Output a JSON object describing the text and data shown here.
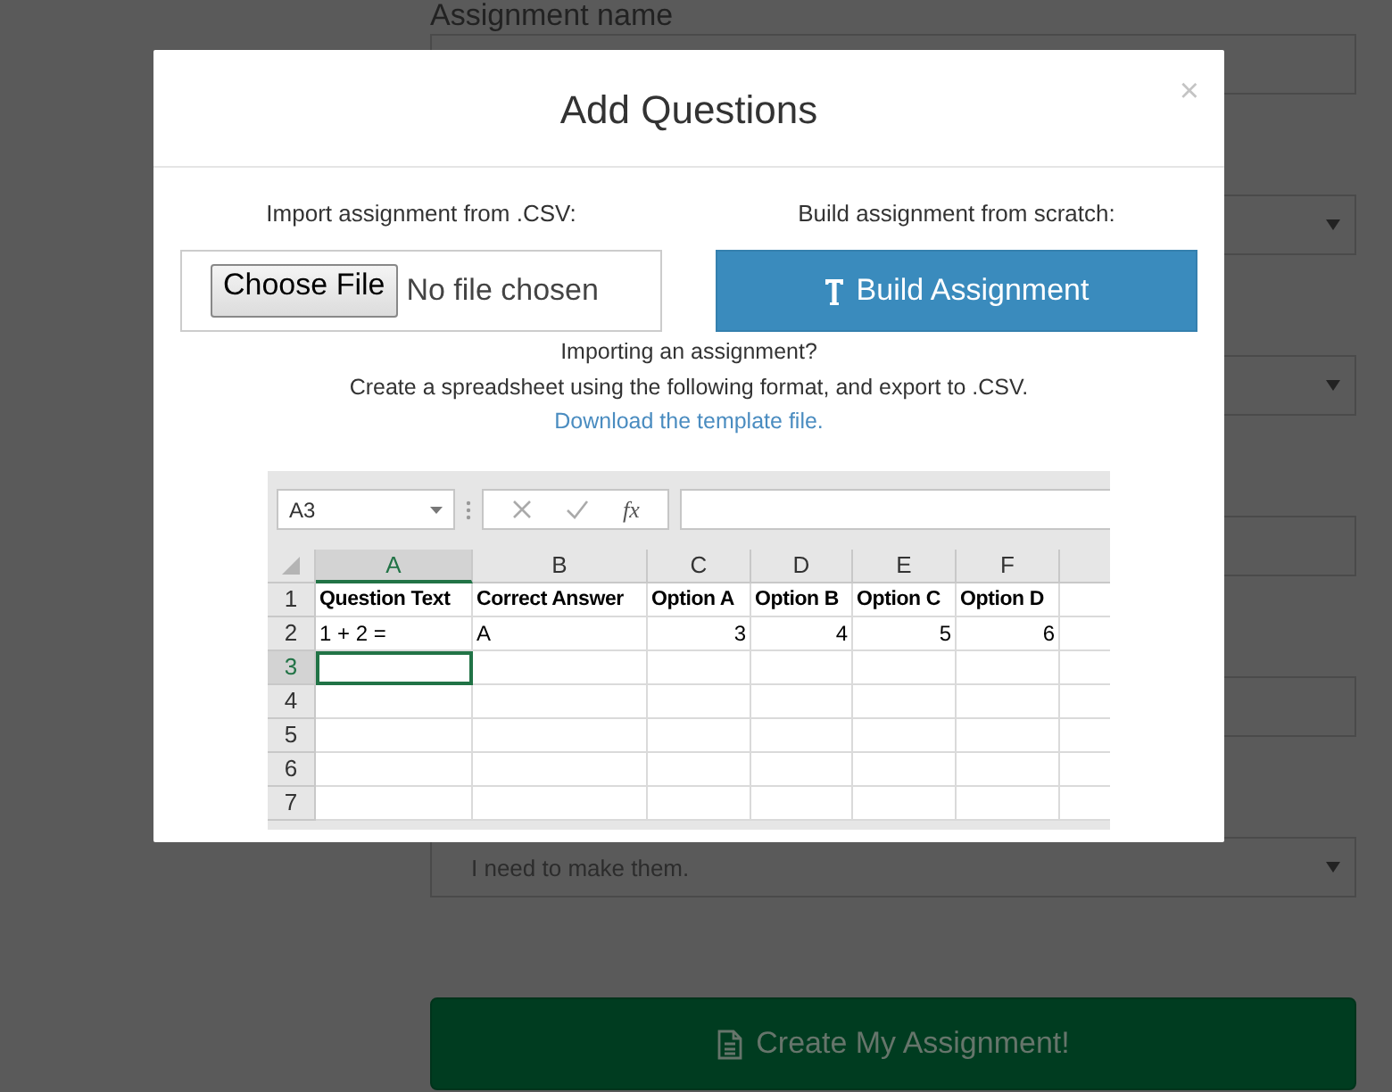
{
  "background_form": {
    "heading": "Assignment name",
    "fields": [
      {
        "kind": "input"
      },
      {
        "kind": "select"
      },
      {
        "kind": "select"
      },
      {
        "kind": "input"
      },
      {
        "kind": "input"
      },
      {
        "kind": "select",
        "value": "I need to make them."
      }
    ],
    "submit_button": "Create My Assignment!"
  },
  "modal": {
    "title": "Add Questions",
    "close": "×",
    "import_label": "Import assignment from .CSV:",
    "file_button": "Choose File",
    "file_status": "No file chosen",
    "build_label": "Build assignment from scratch:",
    "build_button": "Build Assignment",
    "help_lines": [
      "Importing an assignment?",
      "Create a spreadsheet using the following format, and export to .CSV."
    ],
    "template_link": "Download the template file.",
    "spreadsheet": {
      "name_box": "A3",
      "formula_symbol": "fx",
      "columns": [
        {
          "label": "A",
          "selected": true
        },
        {
          "label": "B",
          "selected": false
        },
        {
          "label": "C",
          "selected": false
        },
        {
          "label": "D",
          "selected": false
        },
        {
          "label": "E",
          "selected": false
        },
        {
          "label": "F",
          "selected": false
        }
      ],
      "rows": [
        {
          "label": "1",
          "selected": false,
          "kind": "header",
          "cells": [
            {
              "text": "Question Text",
              "kind": "text",
              "selected": false
            },
            {
              "text": "Correct Answer",
              "kind": "text",
              "selected": false
            },
            {
              "text": "Option A",
              "kind": "text",
              "selected": false
            },
            {
              "text": "Option B",
              "kind": "text",
              "selected": false
            },
            {
              "text": "Option C",
              "kind": "text",
              "selected": false
            },
            {
              "text": "Option D",
              "kind": "text",
              "selected": false
            }
          ]
        },
        {
          "label": "2",
          "selected": false,
          "kind": "data",
          "cells": [
            {
              "text": "1 + 2 =",
              "kind": "text",
              "selected": false
            },
            {
              "text": "A",
              "kind": "text",
              "selected": false
            },
            {
              "text": "3",
              "kind": "number",
              "selected": false
            },
            {
              "text": "4",
              "kind": "number",
              "selected": false
            },
            {
              "text": "5",
              "kind": "number",
              "selected": false
            },
            {
              "text": "6",
              "kind": "number",
              "selected": false
            }
          ]
        },
        {
          "label": "3",
          "selected": true,
          "kind": "data",
          "cells": [
            {
              "selected": true
            },
            {
              "selected": false
            },
            {
              "selected": false
            },
            {
              "selected": false
            },
            {
              "selected": false
            },
            {
              "selected": false
            }
          ]
        },
        {
          "label": "4",
          "selected": false,
          "kind": "data",
          "cells": [
            {
              "selected": false
            },
            {
              "selected": false
            },
            {
              "selected": false
            },
            {
              "selected": false
            },
            {
              "selected": false
            },
            {
              "selected": false
            }
          ]
        },
        {
          "label": "5",
          "selected": false,
          "kind": "data",
          "cells": [
            {
              "selected": false
            },
            {
              "selected": false
            },
            {
              "selected": false
            },
            {
              "selected": false
            },
            {
              "selected": false
            },
            {
              "selected": false
            }
          ]
        },
        {
          "label": "6",
          "selected": false,
          "kind": "data",
          "cells": [
            {
              "selected": false
            },
            {
              "selected": false
            },
            {
              "selected": false
            },
            {
              "selected": false
            },
            {
              "selected": false
            },
            {
              "selected": false
            }
          ]
        },
        {
          "label": "7",
          "selected": false,
          "kind": "data",
          "cells": [
            {
              "selected": false
            },
            {
              "selected": false
            },
            {
              "selected": false
            },
            {
              "selected": false
            },
            {
              "selected": false
            },
            {
              "selected": false
            }
          ]
        }
      ]
    }
  }
}
